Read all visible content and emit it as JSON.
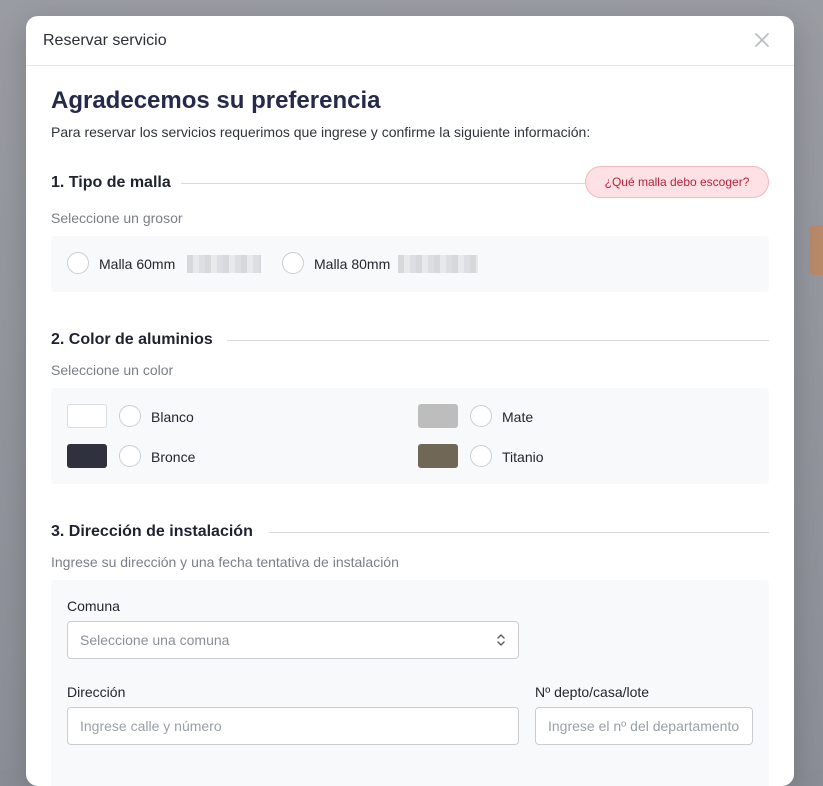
{
  "modal": {
    "title": "Reservar servicio"
  },
  "header": {
    "heading": "Agradecemos su preferencia",
    "intro": "Para reservar los servicios requerimos que ingrese y confirme la siguiente información:"
  },
  "section1": {
    "title": "1. Tipo de malla",
    "help": "¿Qué malla debo escoger?",
    "sublabel": "Seleccione un grosor",
    "options": [
      {
        "label": "Malla 60mm"
      },
      {
        "label": "Malla 80mm"
      }
    ]
  },
  "section2": {
    "title": "2. Color de aluminios",
    "sublabel": "Seleccione un color",
    "colors": [
      {
        "label": "Blanco",
        "swatch": "#ffffff"
      },
      {
        "label": "Mate",
        "swatch": "#bdbdbd"
      },
      {
        "label": "Bronce",
        "swatch": "#30313f"
      },
      {
        "label": "Titanio",
        "swatch": "#716757"
      }
    ]
  },
  "section3": {
    "title": "3. Dirección de instalación",
    "sublabel": "Ingrese su dirección y una fecha tentativa de instalación",
    "comuna_label": "Comuna",
    "comuna_placeholder": "Seleccione una comuna",
    "direccion_label": "Dirección",
    "direccion_placeholder": "Ingrese calle y número",
    "depto_label": "Nº depto/casa/lote",
    "depto_placeholder": "Ingrese el nº del departamento"
  },
  "icons": {
    "close": "close-icon",
    "select": "chevron-up-down-icon"
  }
}
